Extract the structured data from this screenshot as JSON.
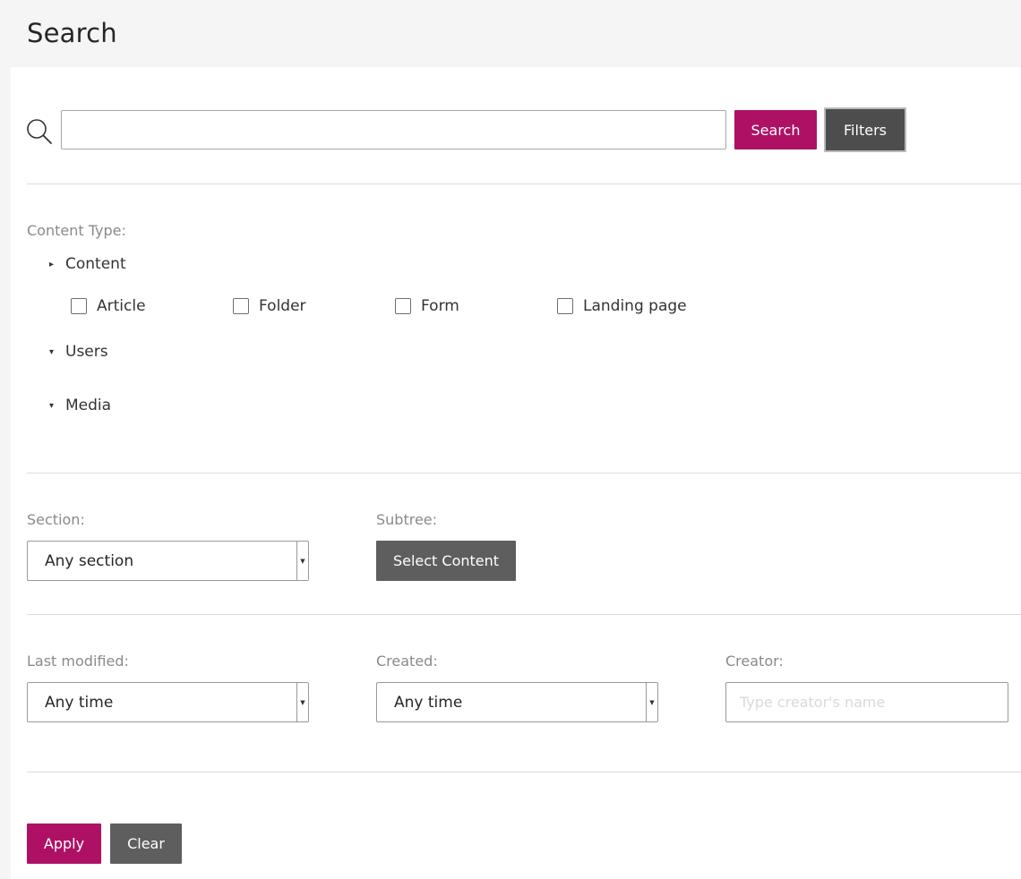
{
  "header": {
    "title": "Search"
  },
  "search": {
    "placeholder": "",
    "value": "",
    "search_label": "Search",
    "filters_label": "Filters"
  },
  "content_type": {
    "label": "Content Type:",
    "groups": [
      {
        "label": "Content",
        "arrow": "▸",
        "expanded": true,
        "options": [
          "Article",
          "Folder",
          "Form",
          "Landing page"
        ]
      },
      {
        "label": "Users",
        "arrow": "▾",
        "expanded": false
      },
      {
        "label": "Media",
        "arrow": "▾",
        "expanded": false
      }
    ]
  },
  "section": {
    "label": "Section:",
    "selected": "Any section"
  },
  "subtree": {
    "label": "Subtree:",
    "button_label": "Select Content"
  },
  "last_modified": {
    "label": "Last modified:",
    "selected": "Any time"
  },
  "created": {
    "label": "Created:",
    "selected": "Any time"
  },
  "creator": {
    "label": "Creator:",
    "placeholder": "Type creator's name"
  },
  "actions": {
    "apply_label": "Apply",
    "clear_label": "Clear"
  },
  "colors": {
    "primary": "#ae1164",
    "dark_button": "#5e5e5e",
    "page_bg": "#f5f5f5"
  },
  "icons": {
    "search": "search-icon",
    "select_arrow": "caret-down-icon"
  }
}
